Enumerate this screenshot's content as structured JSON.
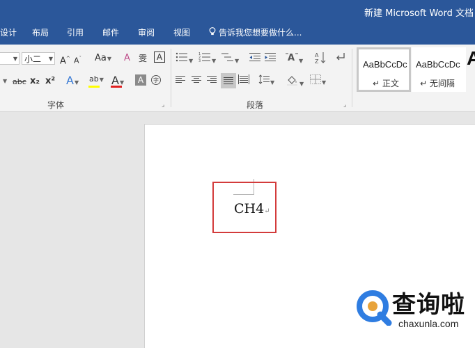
{
  "window": {
    "title": "新建 Microsoft Word 文档"
  },
  "tabs": [
    "设计",
    "布局",
    "引用",
    "邮件",
    "审阅",
    "视图"
  ],
  "tell_me": "告诉我您想要做什么...",
  "font_group": {
    "label": "字体",
    "size_value": "小二",
    "grow_font": "A",
    "shrink_font": "A",
    "change_case": "Aa",
    "clear_format": "A",
    "phonetic": "雯",
    "char_border": "A",
    "strikethrough": "abc",
    "subscript": "x₂",
    "superscript": "x²",
    "text_effect": "A",
    "highlight": "ab",
    "font_color": "A",
    "char_shading": "A",
    "enclose_char": "字"
  },
  "paragraph_group": {
    "label": "段落"
  },
  "styles": [
    {
      "preview": "AaBbCcDc",
      "name": "正文",
      "selected": true
    },
    {
      "preview": "AaBbCcDc",
      "name": "无间隔",
      "selected": false
    }
  ],
  "styles_more": "A",
  "document": {
    "text": "CH4"
  },
  "watermark": {
    "brand": "查询啦",
    "url": "chaxunla.com"
  },
  "colors": {
    "title_bar": "#2b579a",
    "highlight_border": "#d33b3b",
    "highlight_yellow": "#ffff00",
    "font_red": "#e02020",
    "watermark_blue": "#2f7de1"
  }
}
